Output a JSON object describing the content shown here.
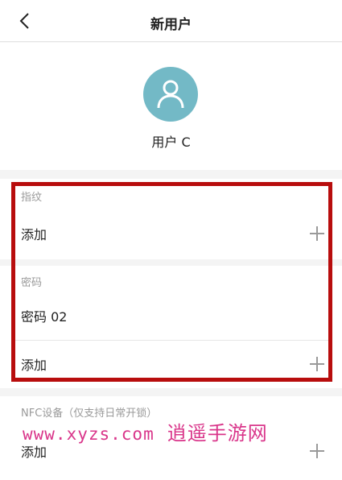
{
  "header": {
    "title": "新用户"
  },
  "profile": {
    "username": "用户 C"
  },
  "fingerprint": {
    "label": "指纹",
    "add_label": "添加"
  },
  "password": {
    "label": "密码",
    "item": "密码 02",
    "add_label": "添加"
  },
  "nfc": {
    "label": "NFC设备（仅支持日常开锁）",
    "add_label": "添加"
  },
  "watermark": {
    "url": "www.xyzs.com",
    "name": "逍遥手游网"
  },
  "colors": {
    "avatar_bg": "#73b9c6",
    "highlight": "#b80d0d",
    "watermark": "#d9358a"
  },
  "icons": {
    "back": "chevron-left-icon",
    "avatar": "user-icon",
    "add": "plus-icon"
  }
}
